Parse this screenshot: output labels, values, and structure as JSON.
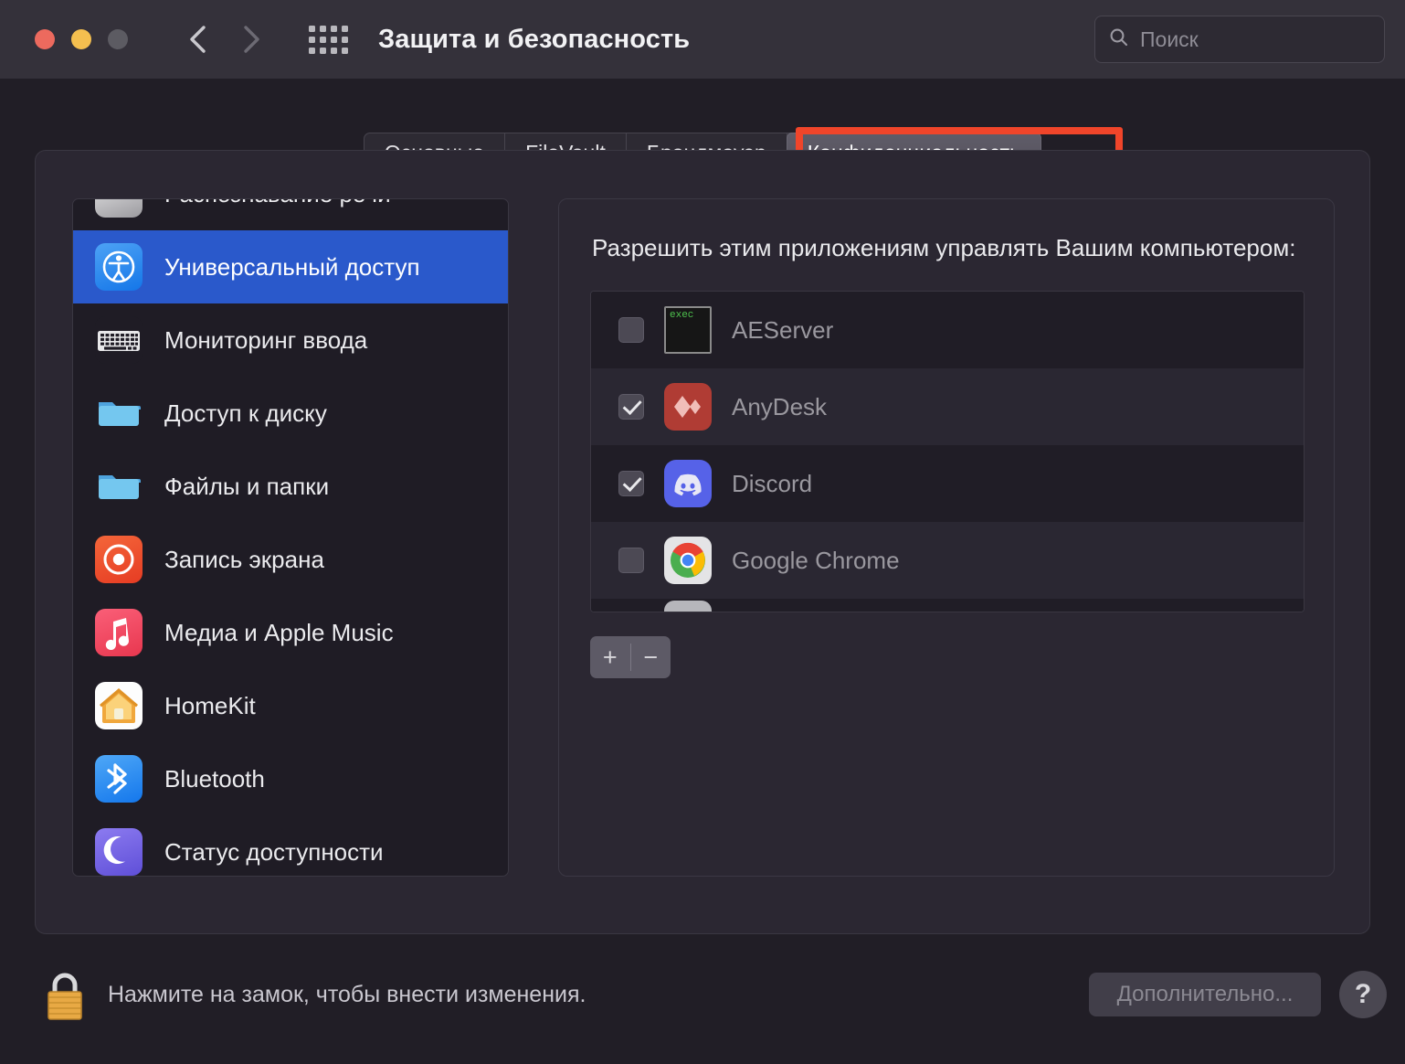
{
  "window": {
    "title": "Защита и безопасность",
    "traffic_lights": [
      "close",
      "minimize",
      "zoom"
    ],
    "back_icon": "chevron-left-icon",
    "forward_icon": "chevron-right-icon",
    "grid_icon": "grid-all-preferences-icon",
    "colors": {
      "close": "#ec6a5e",
      "minimize": "#f4bf4f",
      "zoom": "#5c5b62",
      "titlebar_bg": "#34313a",
      "window_bg": "#211e26",
      "panel_bg": "#2b2732",
      "selection_blue": "#2a59cb",
      "annotation_red": "#f0452a"
    }
  },
  "search": {
    "placeholder": "Поиск",
    "value": "",
    "icon": "search-icon"
  },
  "tabs": [
    {
      "label": "Основные",
      "active": false
    },
    {
      "label": "FileVault",
      "active": false
    },
    {
      "label": "Брандмауэр",
      "active": false
    },
    {
      "label": "Конфиденциальность",
      "active": true
    }
  ],
  "sidebar": {
    "items": [
      {
        "label": "Распознавание речи",
        "icon": "speech-recognition-icon",
        "selected": false,
        "clipped": true
      },
      {
        "label": "Универсальный доступ",
        "icon": "accessibility-icon",
        "selected": true
      },
      {
        "label": "Мониторинг ввода",
        "icon": "keyboard-icon",
        "selected": false
      },
      {
        "label": "Доступ к диску",
        "icon": "folder-icon",
        "selected": false
      },
      {
        "label": "Файлы и папки",
        "icon": "folder-icon",
        "selected": false
      },
      {
        "label": "Запись экрана",
        "icon": "screen-recording-icon",
        "selected": false
      },
      {
        "label": "Медиа и Apple Music",
        "icon": "music-note-icon",
        "selected": false
      },
      {
        "label": "HomeKit",
        "icon": "home-icon",
        "selected": false
      },
      {
        "label": "Bluetooth",
        "icon": "bluetooth-icon",
        "selected": false
      },
      {
        "label": "Статус доступности",
        "icon": "moon-icon",
        "selected": false,
        "clipped": true
      }
    ]
  },
  "main": {
    "heading": "Разрешить этим приложениям управлять Вашим компьютером:",
    "apps": [
      {
        "name": "AEServer",
        "checked": false,
        "icon": "exec-terminal-icon",
        "icon_text": "exec"
      },
      {
        "name": "AnyDesk",
        "checked": true,
        "icon": "anydesk-icon"
      },
      {
        "name": "Discord",
        "checked": true,
        "icon": "discord-icon"
      },
      {
        "name": "Google Chrome",
        "checked": false,
        "icon": "chrome-icon"
      }
    ],
    "add_label": "+",
    "remove_label": "−"
  },
  "bottom": {
    "lock_icon": "lock-closed-icon",
    "lock_text": "Нажмите на замок, чтобы внести изменения.",
    "advanced_label": "Дополнительно...",
    "help_label": "?"
  }
}
